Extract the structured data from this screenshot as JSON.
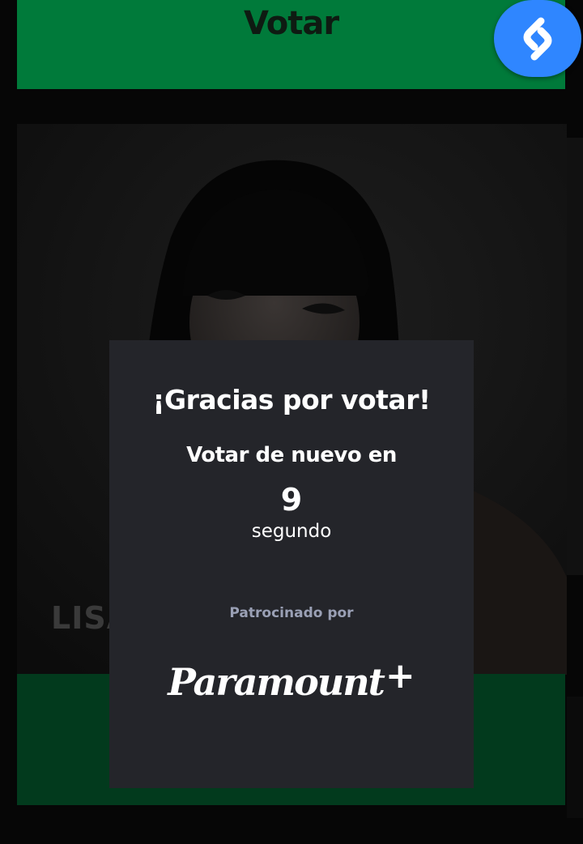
{
  "top_vote": {
    "label": "Votar"
  },
  "shazam": {
    "icon": "shazam-icon",
    "color": "#2f86ff"
  },
  "contestant": {
    "name": "LISA"
  },
  "modal": {
    "title": "¡Gracias por votar!",
    "subtitle": "Votar de nuevo en",
    "countdown": "9",
    "countdown_unit": "segundo",
    "sponsor_label": "Patrocinado por",
    "sponsor_logo_text": "Paramount",
    "sponsor_logo_plus": "+"
  },
  "colors": {
    "vote_green": "#007a3a",
    "modal_bg": "#24252a",
    "sponsor_label": "#9aa0b5"
  }
}
